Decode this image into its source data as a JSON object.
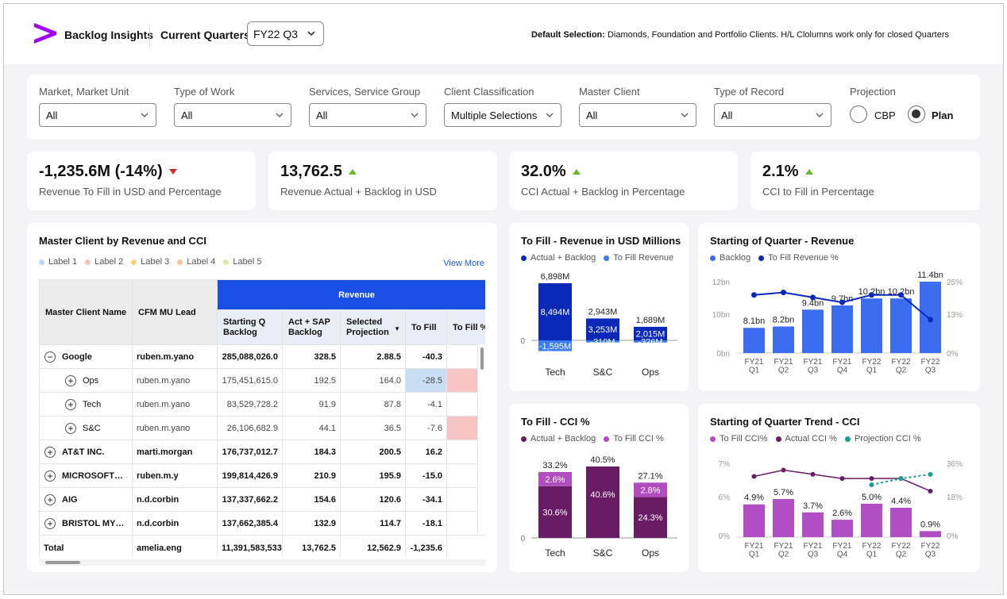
{
  "app": {
    "name": "Backlog Insights",
    "current_quarters_label": "Current Quarters",
    "quarter_value": "FY22 Q3",
    "default_selection_label": "Default Selection:",
    "default_selection_text": "Diamonds, Foundation and Portfolio Clients. H/L Clolumns work only for closed Quarters"
  },
  "filters": [
    {
      "label": "Market, Market Unit",
      "value": "All"
    },
    {
      "label": "Type of Work",
      "value": "All"
    },
    {
      "label": "Services, Service Group",
      "value": "All"
    },
    {
      "label": "Client Classification",
      "value": "Multiple Selections"
    },
    {
      "label": "Master Client",
      "value": "All"
    },
    {
      "label": "Type of Record",
      "value": "All"
    }
  ],
  "projection": {
    "label": "Projection",
    "options": [
      "CBP",
      "Plan"
    ],
    "selected": "Plan"
  },
  "kpis": [
    {
      "value": "-1,235.6M (-14%)",
      "desc": "Revenue To Fill in USD and Percentage",
      "trend": "down"
    },
    {
      "value": "13,762.5",
      "desc": "Revenue Actual + Backlog in USD",
      "trend": "up"
    },
    {
      "value": "32.0%",
      "desc": "CCI Actual + Backlog in Percentage",
      "trend": "up"
    },
    {
      "value": "2.1%",
      "desc": "CCI to Fill in Percentage",
      "trend": "up"
    }
  ],
  "table_card": {
    "title": "Master Client by Revenue and CCI",
    "labels": [
      "Label 1",
      "Label 2",
      "Label 3",
      "Label 4",
      "Label 5"
    ],
    "label_colors": [
      "#bcd6f2",
      "#f7c0c0",
      "#f7d27a",
      "#f6c49c",
      "#d6ee9a"
    ],
    "view_more": "View More",
    "headers": {
      "client": "Master Client Name",
      "lead": "CFM MU Lead",
      "revenue": "Revenue",
      "cols": [
        "Starting Q Backlog",
        "Act + SAP Backlog",
        "Selected Projection",
        "To Fill",
        "To Fill %"
      ]
    },
    "rows": [
      {
        "name": "Google",
        "lead": "ruben.m.yano",
        "v1": "285,088,026.0",
        "v2": "328.5",
        "v3": "2.88.5",
        "v4": "-40.3",
        "level": 0,
        "icon": "minus",
        "bold": true
      },
      {
        "name": "Ops",
        "lead": "ruben.m.yano",
        "v1": "175,451,615.0",
        "v2": "192.5",
        "v3": "164.0",
        "v4": "-28.5",
        "level": 1,
        "icon": "plus",
        "bold": false,
        "hl4": "#c9def3",
        "hl5": "#f8c4c4"
      },
      {
        "name": "Tech",
        "lead": "ruben.m.yano",
        "v1": "83,529,728.2",
        "v2": "91.9",
        "v3": "87.8",
        "v4": "-4.1",
        "level": 1,
        "icon": "plus",
        "bold": false
      },
      {
        "name": "S&C",
        "lead": "ruben.m.yano",
        "v1": "26,106,682.9",
        "v2": "44.1",
        "v3": "36.5",
        "v4": "-7.6",
        "level": 1,
        "icon": "plus",
        "bold": false,
        "hl5": "#f8c4c4"
      },
      {
        "name": "AT&T INC.",
        "lead": "marti.morgan",
        "v1": "176,737,012.7",
        "v2": "184.3",
        "v3": "200.5",
        "v4": "16.2",
        "level": 0,
        "icon": "plus",
        "bold": true
      },
      {
        "name": "MICROSOFT…",
        "lead": "ruben.m.y",
        "v1": "199,814,426.9",
        "v2": "210.9",
        "v3": "195.9",
        "v4": "-15.0",
        "level": 0,
        "icon": "plus",
        "bold": true
      },
      {
        "name": "AIG",
        "lead": "n.d.corbin",
        "v1": "137,337,662.2",
        "v2": "154.6",
        "v3": "120.6",
        "v4": "-34.1",
        "level": 0,
        "icon": "plus",
        "bold": true
      },
      {
        "name": "BRISTOL MY…",
        "lead": "n.d.corbin",
        "v1": "137,662,385.4",
        "v2": "132.9",
        "v3": "114.7",
        "v4": "-18.1",
        "level": 0,
        "icon": "plus",
        "bold": true
      }
    ],
    "total": {
      "name": "Total",
      "lead": "amelia.eng",
      "v1": "11,391,583,533",
      "v2": "13,762.5",
      "v3": "12,562.9",
      "v4": "-1,235.6",
      "v5": "-"
    }
  },
  "chart_data": [
    {
      "type": "bar",
      "title": "To Fill - Revenue in USD Millions",
      "categories": [
        "Tech",
        "S&C",
        "Ops"
      ],
      "series": [
        {
          "name": "Actual + Backlog",
          "values": [
            8494,
            3253,
            2015
          ],
          "labels": [
            "8,494M",
            "3,253M",
            "2,015M"
          ]
        },
        {
          "name": "To Fill Revenue",
          "values": [
            -1595,
            -310,
            -326
          ],
          "labels": [
            "-1,595M",
            "-310M",
            "-326M"
          ]
        }
      ],
      "totals": [
        "6,898M",
        "2,943M",
        "1,689M"
      ],
      "y_ticks": [
        "0"
      ],
      "colors": [
        "#0a29b8",
        "#3c7dee"
      ]
    },
    {
      "type": "bar",
      "title": "Starting of Quarter - Revenue",
      "categories": [
        "FY21\nQ1",
        "FY21\nQ2",
        "FY21\nQ3",
        "FY21\nQ4",
        "FY22\nQ1",
        "FY22\nQ2",
        "FY22\nQ3"
      ],
      "series": [
        {
          "name": "Backlog",
          "values": [
            8.1,
            8.2,
            9.4,
            9.7,
            10.2,
            10.2,
            11.4
          ],
          "labels": [
            "8.1bn",
            "8.2bn",
            "9.4bn",
            "9.7bn",
            "10.2bn",
            "10.2bn",
            "11.4bn"
          ]
        },
        {
          "name": "To Fill Revenue %",
          "values": [
            19,
            20,
            18,
            16,
            19,
            19,
            9
          ]
        }
      ],
      "y_left_ticks": [
        "12bn",
        "10bn",
        "0bn"
      ],
      "y_right_ticks": [
        "25%",
        "13%",
        "0%"
      ],
      "colors": [
        "#3c6df0",
        "#0a29b8"
      ]
    },
    {
      "type": "bar",
      "title": "To Fill - CCI %",
      "categories": [
        "Tech",
        "S&C",
        "Ops"
      ],
      "series": [
        {
          "name": "Actual + Backlog",
          "values": [
            30.6,
            40.6,
            24.3
          ],
          "labels": [
            "30.6%",
            "40.6%",
            "24.3%"
          ]
        },
        {
          "name": "To Fill CCI %",
          "values": [
            2.6,
            0,
            2.8
          ],
          "labels": [
            "2.6%",
            "",
            "2.8%"
          ]
        }
      ],
      "totals": [
        "33.2%",
        "40.5%",
        "27.1%"
      ],
      "y_ticks": [
        "0"
      ],
      "colors": [
        "#6a1b66",
        "#b24dc0"
      ]
    },
    {
      "type": "bar",
      "title": "Starting of Quarter Trend - CCI",
      "categories": [
        "FY21\nQ1",
        "FY21\nQ2",
        "FY21\nQ3",
        "FY21\nQ4",
        "FY22\nQ1",
        "FY22\nQ2",
        "FY22\nQ3"
      ],
      "series": [
        {
          "name": "To Fill CCI%",
          "values": [
            4.9,
            5.7,
            3.7,
            2.6,
            5.0,
            4.4,
            0.9
          ],
          "labels": [
            "4.9%",
            "5.7%",
            "3.7%",
            "2.6%",
            "5.0%",
            "4.4%",
            "0.9%"
          ]
        },
        {
          "name": "Actual CCI %",
          "values": [
            29,
            32,
            30,
            28,
            28,
            28,
            22
          ]
        },
        {
          "name": "Projection CCI %",
          "values": [
            null,
            null,
            null,
            null,
            25,
            28,
            30
          ]
        }
      ],
      "y_left_ticks": [
        "7%",
        "6%",
        "0%"
      ],
      "y_right_ticks": [
        "36%",
        "18%",
        "0%"
      ],
      "colors": [
        "#b14ec3",
        "#6a1b66",
        "#1b9e8f"
      ]
    }
  ]
}
